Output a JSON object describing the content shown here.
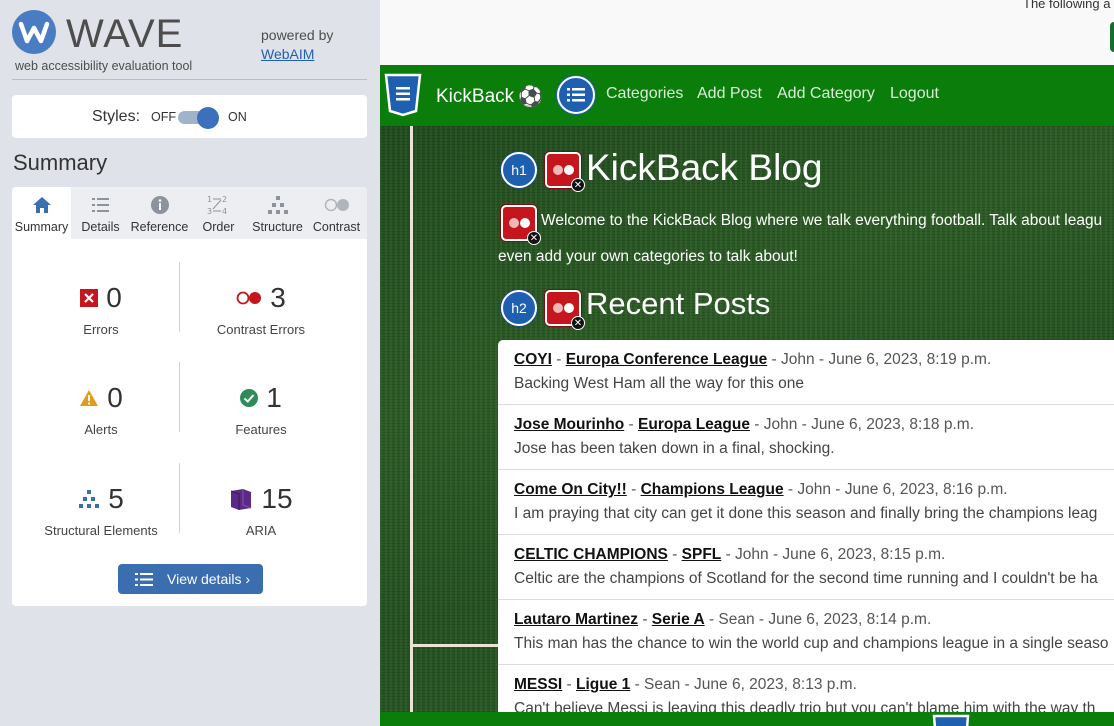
{
  "wave": {
    "name": "WAVE",
    "tagline": "web accessibility evaluation tool",
    "powered_by": "powered by",
    "webaim_link": "WebAIM",
    "styles_label": "Styles:",
    "styles_off": "OFF",
    "styles_on": "ON",
    "summary_title": "Summary",
    "tabs": [
      {
        "label": "Summary",
        "icon": "home-icon",
        "active": true
      },
      {
        "label": "Details",
        "icon": "list-icon"
      },
      {
        "label": "Reference",
        "icon": "info-icon"
      },
      {
        "label": "Order",
        "icon": "order-icon"
      },
      {
        "label": "Structure",
        "icon": "structure-icon"
      },
      {
        "label": "Contrast",
        "icon": "contrast-icon"
      }
    ],
    "stats": {
      "errors": {
        "count": "0",
        "label": "Errors",
        "color": "#c4161c"
      },
      "contrast_errors": {
        "count": "3",
        "label": "Contrast Errors",
        "color": "#c4161c"
      },
      "alerts": {
        "count": "0",
        "label": "Alerts",
        "color": "#e39b1b"
      },
      "features": {
        "count": "1",
        "label": "Features",
        "color": "#2e8b57"
      },
      "structural": {
        "count": "5",
        "label": "Structural Elements",
        "color": "#3b6eaf"
      },
      "aria": {
        "count": "15",
        "label": "ARIA",
        "color": "#5b2a86"
      }
    },
    "view_details": "View details ›"
  },
  "page": {
    "top_note": "The following a",
    "brand": "KickBack",
    "brand_icon": "soccer-ball-icon",
    "nav": [
      "Categories",
      "Add Post",
      "Add Category",
      "Logout"
    ],
    "h1": "KickBack Blog",
    "h1_marker": "h1",
    "h2_marker": "h2",
    "welcome_line1": "Welcome to the KickBack Blog where we talk everything football. Talk about leagu",
    "welcome_line2": "even add your own categories to talk about!",
    "h2": "Recent Posts",
    "posts": [
      {
        "title": "COYI",
        "category": "Europa Conference League",
        "meta": " - John - June 6, 2023, 8:19 p.m.",
        "body": "Backing West Ham all the way for this one"
      },
      {
        "title": "Jose Mourinho",
        "category": "Europa League",
        "meta": " - John - June 6, 2023, 8:18 p.m.",
        "body": "Jose has been taken down in a final, shocking."
      },
      {
        "title": "Come On City!!",
        "category": "Champions League",
        "meta": " - John - June 6, 2023, 8:16 p.m.",
        "body": "I am praying that city can get it done this season and finally bring the champions leag"
      },
      {
        "title": "CELTIC CHAMPIONS",
        "category": "SPFL",
        "meta": " - John - June 6, 2023, 8:15 p.m.",
        "body": "Celtic are the champions of Scotland for the second time running and I couldn't be ha"
      },
      {
        "title": "Lautaro Martinez",
        "category": "Serie A",
        "meta": " - Sean - June 6, 2023, 8:14 p.m.",
        "body": "This man has the chance to win the world cup and champions league in a single seaso"
      },
      {
        "title": "MESSI",
        "category": "Ligue 1",
        "meta": " - Sean - June 6, 2023, 8:13 p.m.",
        "body": "Can't believe Messi is leaving this deadly trio but you can't blame him with the way th"
      }
    ]
  }
}
